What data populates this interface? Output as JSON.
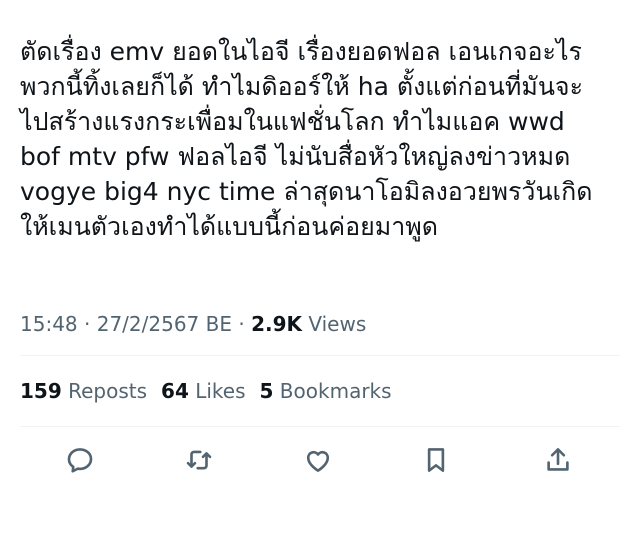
{
  "tweet": {
    "text_lines": [
      "ตัดเรื่อง emv ยอดในไอจี เรื่องยอดฟอล เอนเกจอะไร",
      "พวกนี้ทิ้งเลยก็ได้ ทำไมดิออร์ให้ ha ตั้งแต่ก่อนที่มันจะ",
      "ไปสร้างแรงกระเพื่อมในแฟชั่นโลก ทำไมแอค wwd",
      "bof mtv pfw ฟอลไอจี ไม่นับสื่อหัวใหญ่ลงข่าวหมด",
      "vogye big4 nyc time ล่าสุดนาโอมิลงอวยพรวันเกิด",
      "ให้เมนตัวเองทำได้แบบนี้ก่อนค่อยมาพูด"
    ]
  },
  "meta": {
    "time": "15:48",
    "separator1": " · ",
    "date": "27/2/2567 BE",
    "separator2": " · ",
    "views_count": "2.9K",
    "views_label": " Views"
  },
  "stats": {
    "reposts_count": "159",
    "reposts_label": " Reposts",
    "likes_count": "64",
    "likes_label": " Likes",
    "bookmarks_count": "5",
    "bookmarks_label": " Bookmarks"
  },
  "actions": {
    "icons": [
      "reply-icon",
      "repost-icon",
      "like-icon",
      "bookmark-icon",
      "share-icon"
    ],
    "icon_color": "#536471"
  },
  "colors": {
    "text": "#0f1419",
    "secondary": "#536471",
    "divider": "#eff3f4",
    "background": "#ffffff"
  }
}
